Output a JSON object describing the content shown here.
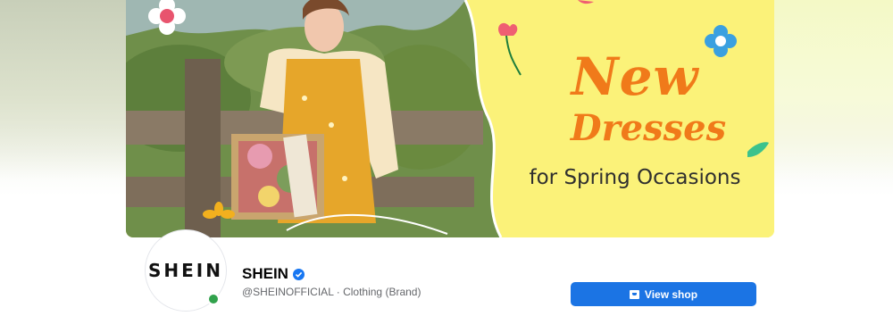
{
  "cover": {
    "headline_line1": "New",
    "headline_line2": "Dresses",
    "subline": "for Spring Occasions"
  },
  "profile": {
    "avatar_text": "SHEIN",
    "name": "SHEIN",
    "verified": true,
    "handle_category": "@SHEINOFFICIAL · Clothing (Brand)",
    "online": true
  },
  "actions": {
    "view_shop_label": "View shop",
    "view_shop_icon": "shop-icon"
  },
  "colors": {
    "accent": "#1b74e4",
    "headline": "#f07a1a",
    "banner_bg": "#fbf279",
    "online": "#31a24c"
  }
}
